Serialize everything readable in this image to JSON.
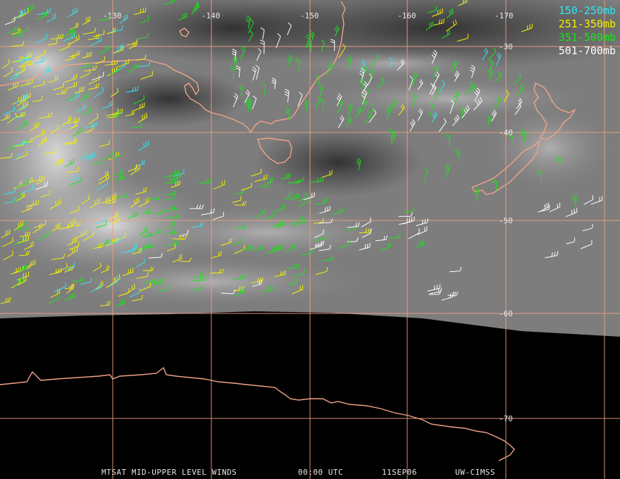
{
  "map": {
    "longitude_labels": [
      "-130",
      "-140",
      "-150",
      "-160",
      "-170"
    ],
    "latitude_labels": [
      "-30",
      "-40",
      "-50",
      "-60",
      "-70"
    ]
  },
  "legend": [
    {
      "label": "150-250mb",
      "color": "#33e6f0"
    },
    {
      "label": "251-350mb",
      "color": "#f5f000"
    },
    {
      "label": "351-500mb",
      "color": "#19e619"
    },
    {
      "label": "501-700mb",
      "color": "#ffffff"
    }
  ],
  "footer": {
    "product": "MTSAT MID-UPPER LEVEL WINDS",
    "time": "00:00 UTC",
    "date": "11SEP06",
    "source": "UW-CIMSS"
  },
  "colors": {
    "grid": "#f0a080",
    "coastline": "#f2a488",
    "background": "#000000"
  }
}
